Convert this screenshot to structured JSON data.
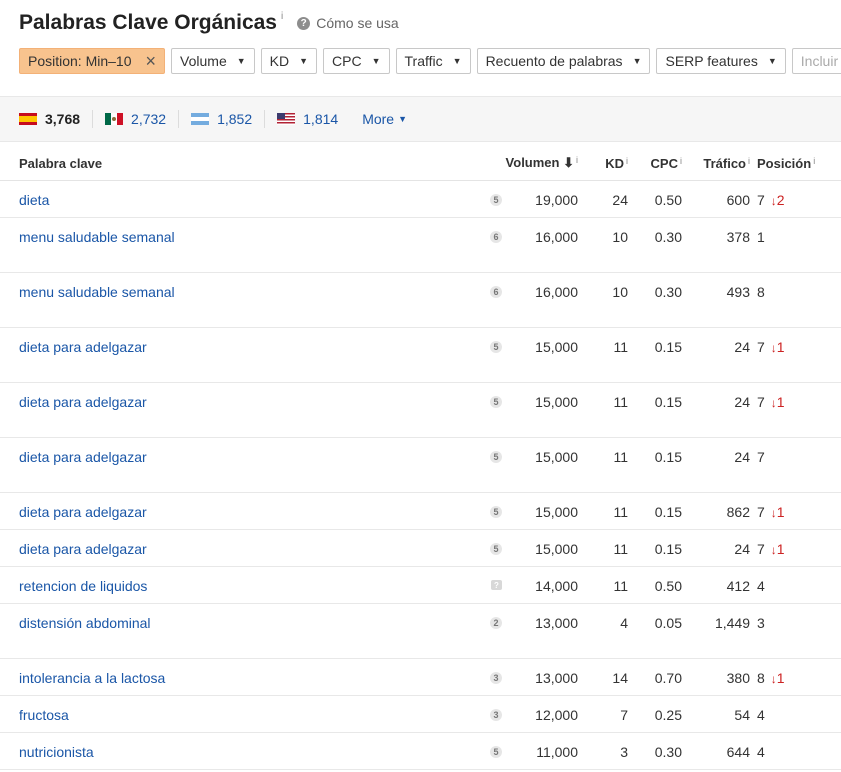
{
  "header": {
    "title": "Palabras Clave Orgánicas",
    "info": "i",
    "help_label": "Cómo se usa",
    "help_glyph": "?"
  },
  "filters": {
    "active": {
      "label": "Position: Min–10",
      "remove_glyph": "×"
    },
    "dropdowns": [
      "Volume",
      "KD",
      "CPC",
      "Traffic",
      "Recuento de palabras",
      "SERP features"
    ],
    "include_placeholder": "Incluir"
  },
  "countries": [
    {
      "flag": "spain-flag-icon",
      "count": "3,768"
    },
    {
      "flag": "mexico-flag-icon",
      "count": "2,732"
    },
    {
      "flag": "argentina-flag-icon",
      "count": "1,852"
    },
    {
      "flag": "usa-flag-icon",
      "count": "1,814"
    }
  ],
  "more_label": "More",
  "table": {
    "headers": {
      "keyword": "Palabra clave",
      "volume": "Volumen",
      "kd": "KD",
      "cpc": "CPC",
      "traffic": "Tráfico",
      "position": "Posición",
      "info": "i"
    },
    "rows": [
      {
        "keyword": "dieta",
        "serp": "5",
        "volume": "19,000",
        "kd": "24",
        "cpc": "0.50",
        "traffic": "600",
        "position": "7",
        "change": "2",
        "tall": false
      },
      {
        "keyword": "menu saludable semanal",
        "serp": "6",
        "volume": "16,000",
        "kd": "10",
        "cpc": "0.30",
        "traffic": "378",
        "position": "1",
        "change": "",
        "tall": true
      },
      {
        "keyword": "menu saludable semanal",
        "serp": "6",
        "volume": "16,000",
        "kd": "10",
        "cpc": "0.30",
        "traffic": "493",
        "position": "8",
        "change": "",
        "tall": true
      },
      {
        "keyword": "dieta para adelgazar",
        "serp": "5",
        "volume": "15,000",
        "kd": "11",
        "cpc": "0.15",
        "traffic": "24",
        "position": "7",
        "change": "1",
        "tall": true
      },
      {
        "keyword": "dieta para adelgazar",
        "serp": "5",
        "volume": "15,000",
        "kd": "11",
        "cpc": "0.15",
        "traffic": "24",
        "position": "7",
        "change": "1",
        "tall": true
      },
      {
        "keyword": "dieta para adelgazar",
        "serp": "5",
        "volume": "15,000",
        "kd": "11",
        "cpc": "0.15",
        "traffic": "24",
        "position": "7",
        "change": "",
        "tall": true
      },
      {
        "keyword": "dieta para adelgazar",
        "serp": "5",
        "volume": "15,000",
        "kd": "11",
        "cpc": "0.15",
        "traffic": "862",
        "position": "7",
        "change": "1",
        "tall": false
      },
      {
        "keyword": "dieta para adelgazar",
        "serp": "5",
        "volume": "15,000",
        "kd": "11",
        "cpc": "0.15",
        "traffic": "24",
        "position": "7",
        "change": "1",
        "tall": false
      },
      {
        "keyword": "retencion de liquidos",
        "serp": "?",
        "volume": "14,000",
        "kd": "11",
        "cpc": "0.50",
        "traffic": "412",
        "position": "4",
        "change": "",
        "tall": false
      },
      {
        "keyword": "distensión abdominal",
        "serp": "2",
        "volume": "13,000",
        "kd": "4",
        "cpc": "0.05",
        "traffic": "1,449",
        "position": "3",
        "change": "",
        "tall": true
      },
      {
        "keyword": "intolerancia a la lactosa",
        "serp": "3",
        "volume": "13,000",
        "kd": "14",
        "cpc": "0.70",
        "traffic": "380",
        "position": "8",
        "change": "1",
        "tall": false
      },
      {
        "keyword": "fructosa",
        "serp": "3",
        "volume": "12,000",
        "kd": "7",
        "cpc": "0.25",
        "traffic": "54",
        "position": "4",
        "change": "",
        "tall": false
      },
      {
        "keyword": "nutricionista",
        "serp": "5",
        "volume": "11,000",
        "kd": "3",
        "cpc": "0.30",
        "traffic": "644",
        "position": "4",
        "change": "",
        "tall": false
      }
    ]
  },
  "colors": {
    "link": "#1a56a7",
    "active_filter": "#f8c38e",
    "decline": "#cc2222"
  }
}
